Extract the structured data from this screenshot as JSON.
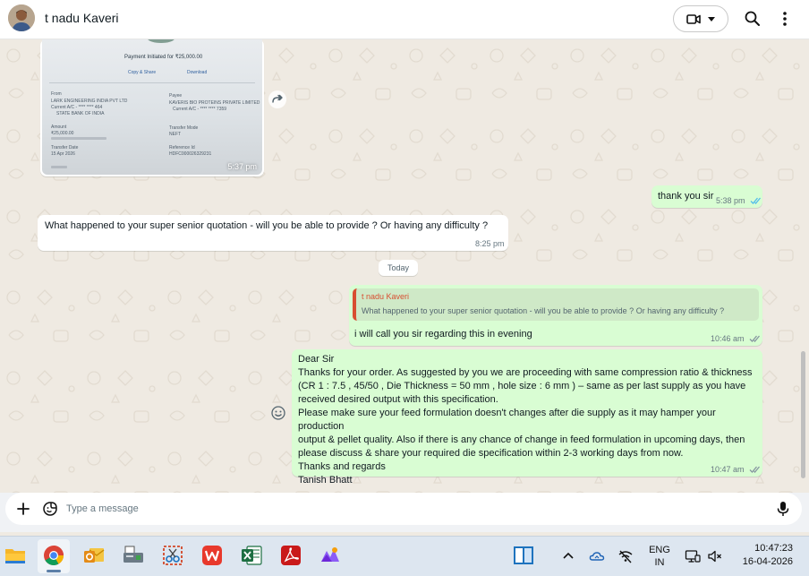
{
  "header": {
    "contact_name": "t nadu Kaveri"
  },
  "messages": {
    "image_doc": {
      "title": "Payment Initiated for ₹25,000.00",
      "copy_label": "Copy & Share",
      "download_label": "Download",
      "from_label": "From",
      "from_name": "LARK ENGINEERING INDIA PVT LTD",
      "from_acct": "Current A/C - **** **** 464",
      "from_bank": "STATE BANK OF INDIA",
      "to_label": "Payee",
      "to_name": "KAVERIS BIO PROTEINS PRIVATE LIMITED",
      "to_acct": "Current A/C - **** **** 7359",
      "amount_label": "Amount",
      "amount": "₹25,000.00",
      "mode_label": "Transfer Mode",
      "mode": "NEFT",
      "date_label": "Transfer Date",
      "date": "15 Apr 2026",
      "ref_label": "Reference Id",
      "ref": "HDFC000026329231",
      "time": "5:37 pm"
    },
    "out_thanks": {
      "text": "thank you sir",
      "time": "5:38 pm"
    },
    "in_question": {
      "text": "What happened to your super senior quotation - will you be able to provide ? Or having any difficulty ?",
      "time": "8:25 pm"
    },
    "date_divider": "Today",
    "out_reply": {
      "quote_author": "t nadu Kaveri",
      "quote_text": "What happened to your super senior quotation - will you be able to provide ? Or having any difficulty ?",
      "text": "i will call you sir regarding this in evening",
      "time": "10:46 am"
    },
    "out_letter": {
      "lines": [
        "Dear Sir",
        "Thanks for your order. As suggested by you we are proceeding with same compression ratio & thickness",
        "(CR 1 : 7.5 ,  45/50 , Die Thickness = 50 mm , hole size : 6 mm  ) – same as per last supply as you have",
        "received desired output with this specification.",
        "Please make sure your feed formulation doesn't changes after die supply as it may hamper your production",
        "output & pellet quality. Also if there is any chance of change in feed formulation in upcoming days, then",
        "please discuss & share your required die specification within 2-3 working days from now.",
        "Thanks and regards",
        "Tanish Bhatt"
      ],
      "time": "10:47 am"
    }
  },
  "composer": {
    "placeholder": "Type a message",
    "value": ""
  },
  "taskbar": {
    "lang_line1": "ENG",
    "lang_line2": "IN",
    "time": "10:47:23",
    "date": "16-04-2026"
  },
  "colors": {
    "outgoing_bubble": "#d9fdd3",
    "incoming_bubble": "#ffffff",
    "chat_bg": "#efeae2",
    "read_ticks": "#53bdeb",
    "quote_accent": "#d84e31"
  }
}
